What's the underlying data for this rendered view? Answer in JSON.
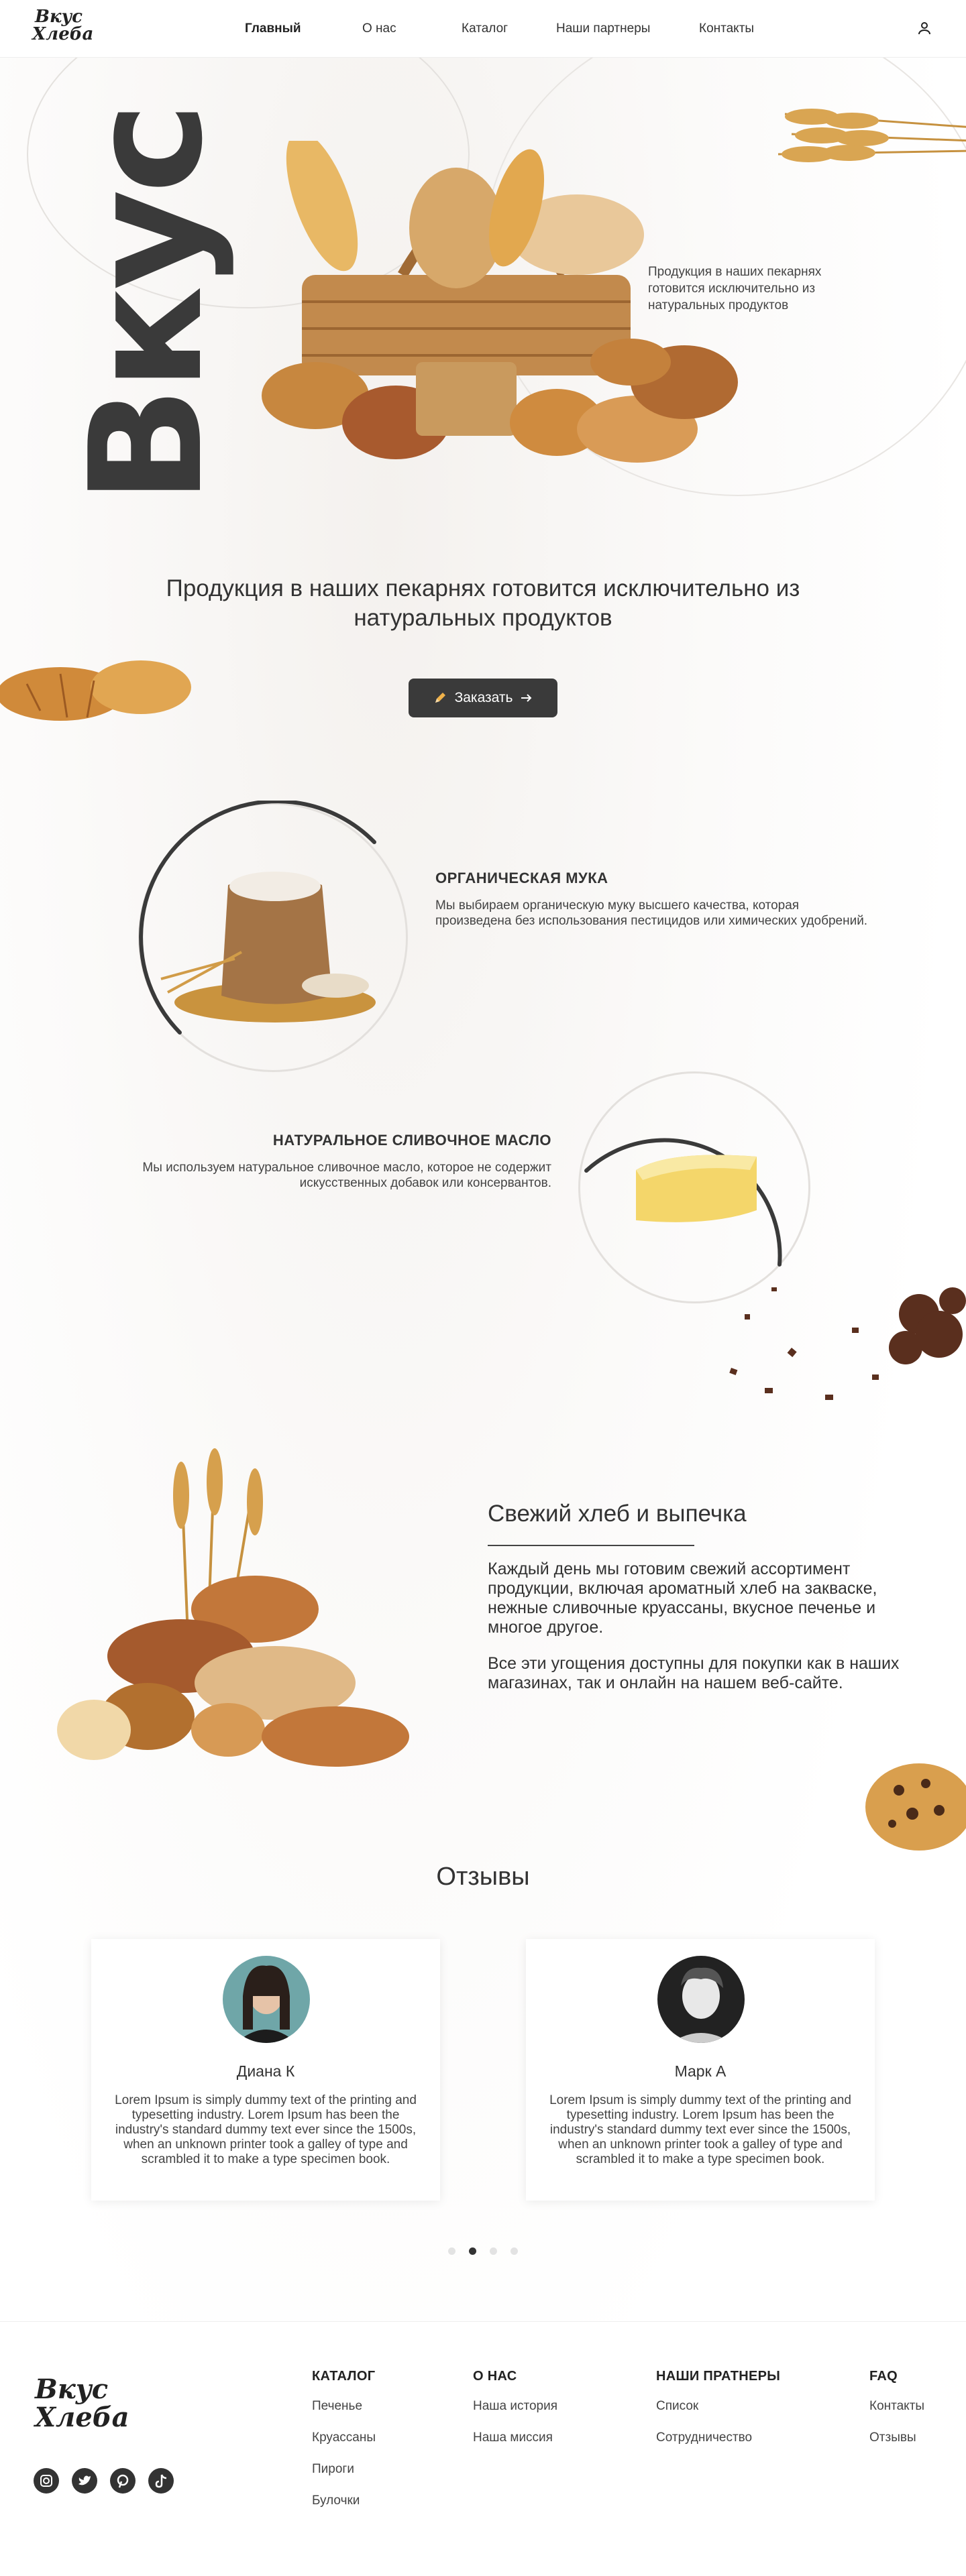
{
  "header": {
    "logo_line1": "Вкус",
    "logo_line2": "Хлеба",
    "nav": [
      {
        "label": "Главный",
        "active": true
      },
      {
        "label": "О нас",
        "active": false
      },
      {
        "label": "Каталог",
        "active": false
      },
      {
        "label": "Наши партнеры",
        "active": false
      },
      {
        "label": "Контакты",
        "active": false
      }
    ],
    "user_icon": "user-icon"
  },
  "hero": {
    "big_word": "Вкус",
    "side_text": "Продукция в наших пекарнях готовится исключительно из натуральных продуктов",
    "headline": "Продукция в наших пекарнях готовится исключительно из натуральных продуктов",
    "order_button": "Заказать",
    "order_icon": "pencil-icon",
    "arrow_icon": "arrow-right-icon"
  },
  "features": [
    {
      "title": "ОРГАНИЧЕСКАЯ МУКА",
      "text": "Мы выбираем органическую муку высшего качества, которая произведена без использования пестицидов или химических удобрений."
    },
    {
      "title": "НАТУРАЛЬНОЕ СЛИВОЧНОЕ МАСЛО",
      "text": "Мы используем натуральное сливочное масло, которое не содержит искусственных добавок или консервантов."
    }
  ],
  "fresh": {
    "title": "Свежий хлеб и выпечка",
    "p1": "Каждый день мы готовим свежий ассортимент продукции, включая ароматный хлеб на закваске, нежные сливочные круассаны, вкусное печенье и многое другое.",
    "p2": "Все эти угощения доступны для покупки как в наших магазинах, так и онлайн на нашем веб-сайте."
  },
  "reviews": {
    "title": "Отзывы",
    "items": [
      {
        "name": "Диана К",
        "text": "Lorem Ipsum is simply dummy text of the printing and typesetting industry. Lorem Ipsum has been the industry's standard dummy text ever since the 1500s, when an unknown printer took a galley of type and scrambled it to make a type specimen book."
      },
      {
        "name": "Марк А",
        "text": "Lorem Ipsum is simply dummy text of the printing and typesetting industry. Lorem Ipsum has been the industry's standard dummy text ever since the 1500s, when an unknown printer took a galley of type and scrambled it to make a type specimen book."
      }
    ],
    "dots_count": 4,
    "active_dot": 2
  },
  "footer": {
    "logo_line1": "Вкус",
    "logo_line2": "Хлеба",
    "socials": [
      "instagram-icon",
      "twitter-icon",
      "pinterest-icon",
      "tiktok-icon"
    ],
    "columns": [
      {
        "title": "КАТАЛОГ",
        "links": [
          "Печенье",
          "Круассаны",
          "Пироги",
          "Булочки"
        ]
      },
      {
        "title": "О НАС",
        "links": [
          "Наша история",
          "Наша миссия"
        ]
      },
      {
        "title": "НАШИ ПРАТНЕРЫ",
        "links": [
          "Список",
          "Сотрудничество"
        ]
      },
      {
        "title": "FAQ",
        "links": [
          "Контакты",
          "Отзывы"
        ]
      }
    ]
  },
  "colors": {
    "accent": "#3a3a3a",
    "text": "#333333",
    "background": "#ffffff"
  }
}
